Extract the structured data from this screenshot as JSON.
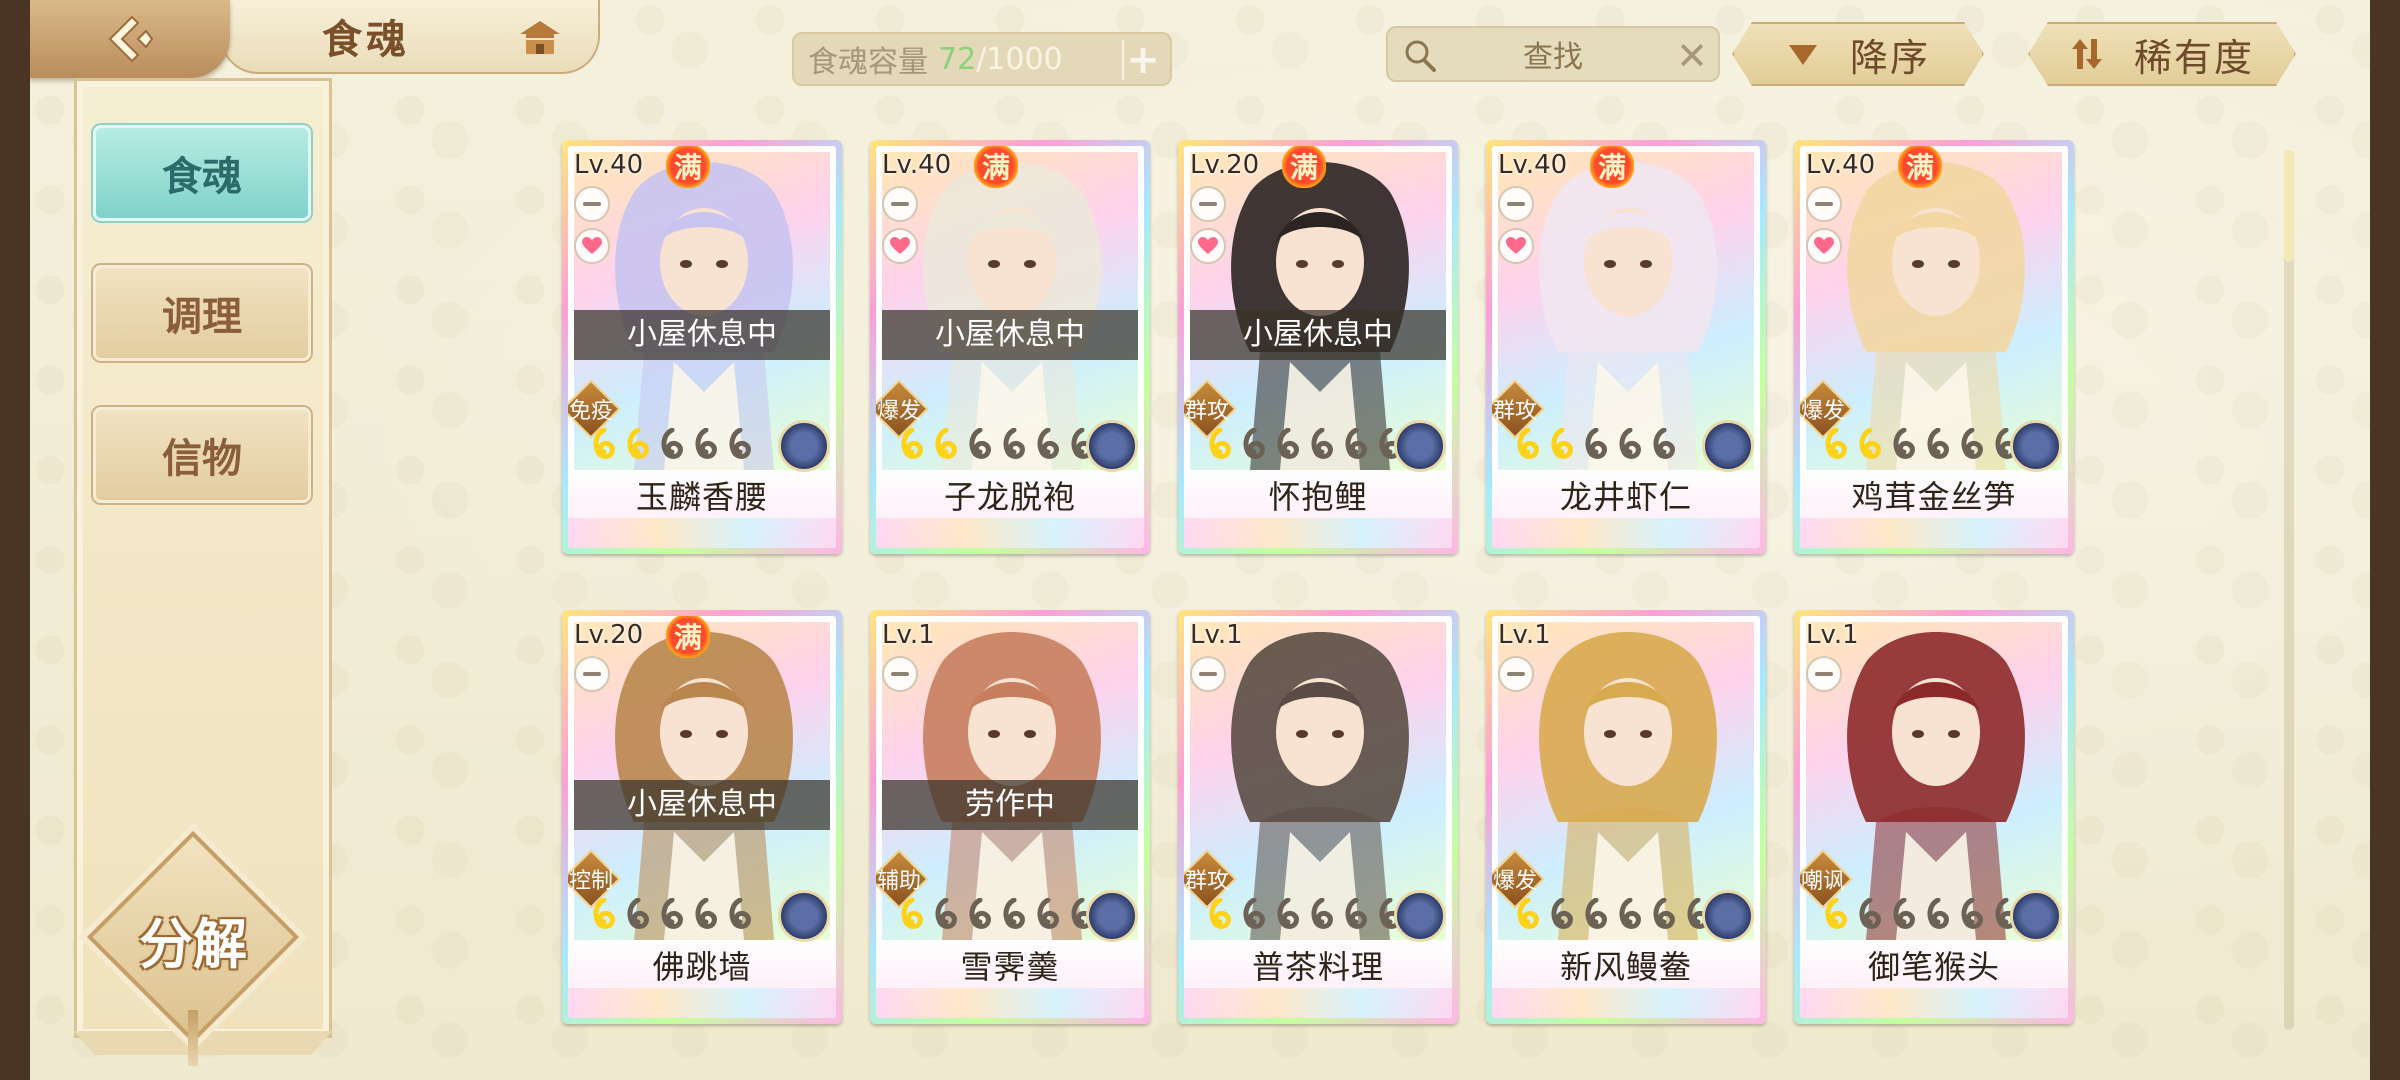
{
  "header": {
    "title": "食魂",
    "capacity_label": "食魂容量",
    "capacity_current": "72",
    "capacity_separator": "/",
    "capacity_max": "1000",
    "search_placeholder": "查找",
    "sort_order_label": "降序",
    "sort_key_label": "稀有度"
  },
  "sidebar": {
    "tabs": [
      {
        "label": "食魂",
        "active": true
      },
      {
        "label": "调理",
        "active": false
      },
      {
        "label": "信物",
        "active": false
      }
    ],
    "decompose_label": "分解"
  },
  "colors": {
    "accent_teal": "#7fd2c8",
    "capacity_green": "#8bd17a",
    "badge_red": "#ff4b2b"
  },
  "cards": [
    {
      "level": "Lv.40",
      "full": "满",
      "status": "小屋休息中",
      "role": "免疫",
      "stars_filled": 2,
      "stars_total": 5,
      "name": "玉麟香腰",
      "favorite": true,
      "hair": "#c9c4ef"
    },
    {
      "level": "Lv.40",
      "full": "满",
      "status": "小屋休息中",
      "role": "爆发",
      "stars_filled": 2,
      "stars_total": 6,
      "name": "子龙脱袍",
      "favorite": true,
      "hair": "#ece8da"
    },
    {
      "level": "Lv.20",
      "full": "满",
      "status": "小屋休息中",
      "role": "群攻",
      "stars_filled": 1,
      "stars_total": 6,
      "name": "怀抱鲤",
      "favorite": true,
      "hair": "#2b2421"
    },
    {
      "level": "Lv.40",
      "full": "满",
      "status": "",
      "role": "群攻",
      "stars_filled": 2,
      "stars_total": 5,
      "name": "龙井虾仁",
      "favorite": true,
      "hair": "#f1e6ef"
    },
    {
      "level": "Lv.40",
      "full": "满",
      "status": "",
      "role": "爆发",
      "stars_filled": 2,
      "stars_total": 6,
      "name": "鸡茸金丝笋",
      "favorite": true,
      "hair": "#f2d7a2"
    },
    {
      "level": "Lv.20",
      "full": "满",
      "status": "小屋休息中",
      "role": "控制",
      "stars_filled": 1,
      "stars_total": 5,
      "name": "佛跳墙",
      "favorite": false,
      "hair": "#b9874d"
    },
    {
      "level": "Lv.1",
      "full": "",
      "status": "劳作中",
      "role": "辅助",
      "stars_filled": 1,
      "stars_total": 6,
      "name": "雪霁羹",
      "favorite": false,
      "hair": "#c77e5e"
    },
    {
      "level": "Lv.1",
      "full": "",
      "status": "",
      "role": "群攻",
      "stars_filled": 1,
      "stars_total": 6,
      "name": "普茶料理",
      "favorite": false,
      "hair": "#5a4c44"
    },
    {
      "level": "Lv.1",
      "full": "",
      "status": "",
      "role": "爆发",
      "stars_filled": 1,
      "stars_total": 6,
      "name": "新风鳗鲞",
      "favorite": false,
      "hair": "#d8aa4f"
    },
    {
      "level": "Lv.1",
      "full": "",
      "status": "",
      "role": "嘲讽",
      "stars_filled": 1,
      "stars_total": 6,
      "name": "御笔猴头",
      "favorite": false,
      "hair": "#8c2a2a"
    }
  ]
}
